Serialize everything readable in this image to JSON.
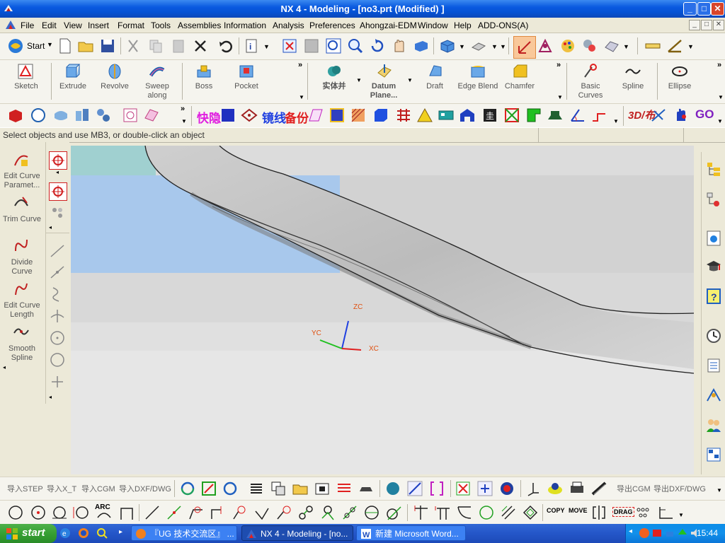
{
  "window": {
    "title": "NX 4 - Modeling - [no3.prt (Modified) ]"
  },
  "menu": [
    "File",
    "Edit",
    "View",
    "Insert",
    "Format",
    "Tools",
    "Assemblies",
    "Information",
    "Analysis",
    "Preferences",
    "Ahongzai-EDM",
    "Window",
    "Help",
    "ADD-ONS(A)"
  ],
  "toolbar_std": {
    "start_label": "Start"
  },
  "toolbar_feature": {
    "items": [
      "Sketch",
      "Extrude",
      "Revolve",
      "Sweep along",
      "Boss",
      "Pocket",
      "实体并",
      "Datum Plane...",
      "Draft",
      "Edge Blend",
      "Chamfer",
      "Basic Curves",
      "Spline",
      "Ellipse"
    ]
  },
  "toolbar_custom": {
    "labels": [
      "快隐",
      "镜线",
      "备份",
      "3D/布",
      "GO"
    ]
  },
  "hint": "Select objects and use MB3, or double-click an object",
  "left_palette": [
    "Edit Curve Paramet...",
    "Trim Curve",
    "Divide Curve",
    "Edit Curve Length",
    "Smooth Spline"
  ],
  "viewport": {
    "axes": {
      "z": "ZC",
      "y": "YC",
      "x": "XC"
    },
    "colors": {
      "z": "#2040e0",
      "y": "#20c020",
      "x": "#e02020",
      "label": "#e05010"
    }
  },
  "bottom_bar": {
    "left_labels": [
      "导入STEP",
      "导入X_T",
      "导入CGM",
      "导入DXF/DWG"
    ],
    "right_labels": [
      "导出CGM",
      "导出DXF/DWG"
    ]
  },
  "bottom_bar2": {
    "text_icons": [
      "ARC",
      "COPY",
      "MOVE",
      "DRAG"
    ]
  },
  "taskbar": {
    "start": "start",
    "tasks": [
      "『UG 技术交流区』 ...",
      "NX 4 - Modeling - [no...",
      "新建 Microsoft Word..."
    ],
    "clock": "15:44"
  }
}
